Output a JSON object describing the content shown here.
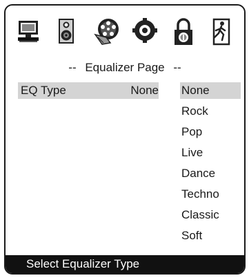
{
  "toolbar": {
    "icons": [
      "monitor-icon",
      "speaker-icon",
      "audio-reel-icon",
      "preferences-icon",
      "password-lock-icon",
      "exit-icon"
    ]
  },
  "page": {
    "title_prefix": "--",
    "title": "Equalizer Page",
    "title_suffix": "--"
  },
  "eq": {
    "label": "EQ Type",
    "value": "None"
  },
  "options": [
    "None",
    "Rock",
    "Pop",
    "Live",
    "Dance",
    "Techno",
    "Classic",
    "Soft"
  ],
  "selected_option": "None",
  "status": {
    "text": "Select Equalizer Type"
  },
  "colors": {
    "highlight": "#d4d4d4",
    "statusbar": "#111111"
  }
}
